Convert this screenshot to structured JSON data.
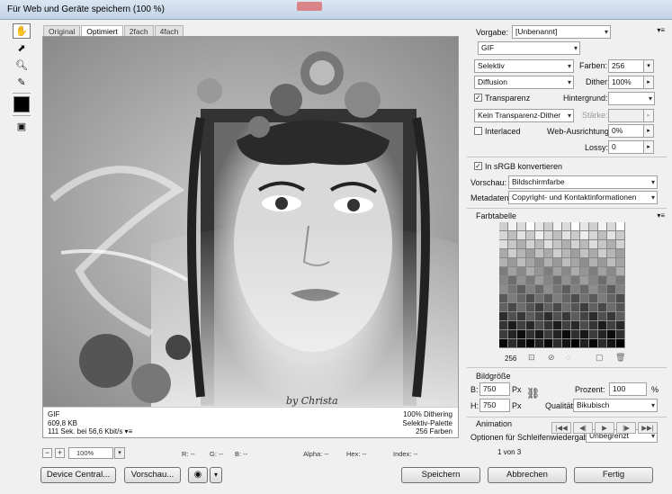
{
  "window": {
    "title": "Für Web und Geräte speichern (100 %)"
  },
  "tabs": [
    {
      "label": "Original"
    },
    {
      "label": "Optimiert"
    },
    {
      "label": "2fach"
    },
    {
      "label": "4fach"
    }
  ],
  "preview": {
    "info_left": [
      "GIF",
      "609,8 KB",
      "111 Sek. bei 56,6 Kbit/s"
    ],
    "info_right": [
      "100% Dithering",
      "Selektiv-Palette",
      "256 Farben"
    ],
    "watermark": "by Christa"
  },
  "status": {
    "zoom_value": "100%",
    "r_label": "R: --",
    "g_label": "G: --",
    "b_label": "B: --",
    "alpha_label": "Alpha: --",
    "hex_label": "Hex: --",
    "index_label": "Index: --"
  },
  "buttons": {
    "device_central": "Device Central...",
    "preview": "Vorschau...",
    "save": "Speichern",
    "cancel": "Abbrechen",
    "done": "Fertig"
  },
  "settings": {
    "preset_label": "Vorgabe:",
    "preset_value": "[Unbenannt]",
    "format_value": "GIF",
    "reduction_value": "Selektiv",
    "colors_label": "Farben:",
    "colors_value": "256",
    "dither_algo_value": "Diffusion",
    "dither_label": "Dither:",
    "dither_value": "100%",
    "transparency_label": "Transparenz",
    "transparency_checked": true,
    "matte_label": "Hintergrund:",
    "matte_value": "",
    "trans_dither_value": "Kein Transparenz-Dither",
    "amount_label": "Stärke:",
    "amount_value": "",
    "interlaced_label": "Interlaced",
    "interlaced_checked": false,
    "websnap_label": "Web-Ausrichtung:",
    "websnap_value": "0%",
    "lossy_label": "Lossy:",
    "lossy_value": "0",
    "srgb_label": "In sRGB konvertieren",
    "srgb_checked": true,
    "preview_label": "Vorschau:",
    "preview_value": "Bildschirmfarbe",
    "metadata_label": "Metadaten:",
    "metadata_value": "Copyright- und Kontaktinformationen"
  },
  "color_table": {
    "title": "Farbtabelle",
    "count": "256"
  },
  "image_size": {
    "title": "Bildgröße",
    "w_label": "B:",
    "w_value": "750",
    "w_unit": "Px",
    "h_label": "H:",
    "h_value": "750",
    "h_unit": "Px",
    "percent_label": "Prozent:",
    "percent_value": "100",
    "percent_unit": "%",
    "quality_label": "Qualität:",
    "quality_value": "Bikubisch"
  },
  "animation": {
    "title": "Animation",
    "loop_label": "Optionen für Schleifenwiedergabe:",
    "loop_value": "Unbegrenzt",
    "frame_counter": "1 von 3"
  }
}
